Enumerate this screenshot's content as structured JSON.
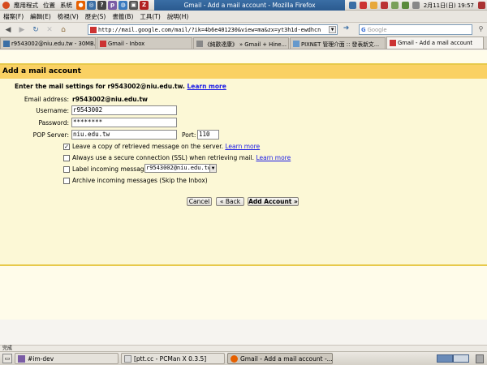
{
  "top_panel": {
    "menus": [
      "應用程式",
      "位置",
      "系統"
    ],
    "window_title": "Gmail - Add a mail account - Mozilla Firefox",
    "clock": "2月11日(日) 19:57",
    "launchers": [
      {
        "icon": "firefox-launcher-icon",
        "color": "#e66000",
        "glyph": "●"
      },
      {
        "icon": "web-launcher-icon",
        "color": "#3a6ea5",
        "glyph": "◎"
      },
      {
        "icon": "help-launcher-icon",
        "color": "#444444",
        "glyph": "?"
      },
      {
        "icon": "pidgin-launcher-icon",
        "color": "#7a5ca5",
        "glyph": "p"
      },
      {
        "icon": "globe-launcher-icon",
        "color": "#3a7abf",
        "glyph": "◍"
      },
      {
        "icon": "image-launcher-icon",
        "color": "#555555",
        "glyph": "▣"
      },
      {
        "icon": "filezilla-launcher-icon",
        "color": "#b22222",
        "glyph": "Z"
      }
    ]
  },
  "menubar": {
    "items": [
      "檔案(F)",
      "編輯(E)",
      "檢視(V)",
      "歷史(S)",
      "書籤(B)",
      "工具(T)",
      "說明(H)"
    ]
  },
  "navbar": {
    "url": "http://mail.google.com/mail/?ik=4b6e401230&view=ma&zx=yt3h1d-ewdhcn",
    "search_placeholder": "Google"
  },
  "tabs": [
    {
      "label": "r9543002@niu.edu.tw - 30MB...",
      "active": false,
      "color": "#3a6ea5"
    },
    {
      "label": "Gmail - Inbox",
      "active": false,
      "color": "#c33333"
    },
    {
      "label": "《純歡達康》 » Gmail + Hine...",
      "active": false,
      "color": "#888888"
    },
    {
      "label": "PIXNET 管理介面 :: 發表新文...",
      "active": false,
      "color": "#6699cc"
    },
    {
      "label": "Gmail - Add a mail account",
      "active": true,
      "color": "#c33333"
    }
  ],
  "page": {
    "heading": "Add a mail account",
    "intro_text": "Enter the mail settings for r9543002@niu.edu.tw.",
    "intro_link": "Learn more",
    "email_label": "Email address:",
    "email_value": "r9543002@niu.edu.tw",
    "username_label": "Username:",
    "username_value": "r9543002",
    "password_label": "Password:",
    "password_value": "********",
    "pop_label": "POP Server:",
    "pop_value": "niu.edu.tw",
    "port_label": "Port:",
    "port_value": "110",
    "options": [
      {
        "label": "Leave a copy of retrieved message on the server.",
        "link": "Learn more",
        "checked": true
      },
      {
        "label": "Always use a secure connection (SSL) when retrieving mail.",
        "link": "Learn more",
        "checked": false
      },
      {
        "label": "Label incoming messages:",
        "link": "",
        "checked": false,
        "select": "r9543002@niu.edu.tw"
      },
      {
        "label": "Archive incoming messages (Skip the Inbox)",
        "link": "",
        "checked": false
      }
    ],
    "cancel_label": "Cancel",
    "back_label": "« Back",
    "add_label": "Add Account »"
  },
  "statusbar": {
    "text": "完成"
  },
  "bottom_panel": {
    "tasks": [
      {
        "label": "#im-dev",
        "active": false
      },
      {
        "label": "[ptt.cc - PCMan X 0.3.5]",
        "active": false
      },
      {
        "label": "Gmail - Add a mail account -...",
        "active": true
      }
    ]
  },
  "colors": {
    "gmail_header": "#fad163",
    "gmail_panel": "#fcf8d6",
    "link": "#1a1ae6",
    "title_bar": "#3a6ea5"
  }
}
